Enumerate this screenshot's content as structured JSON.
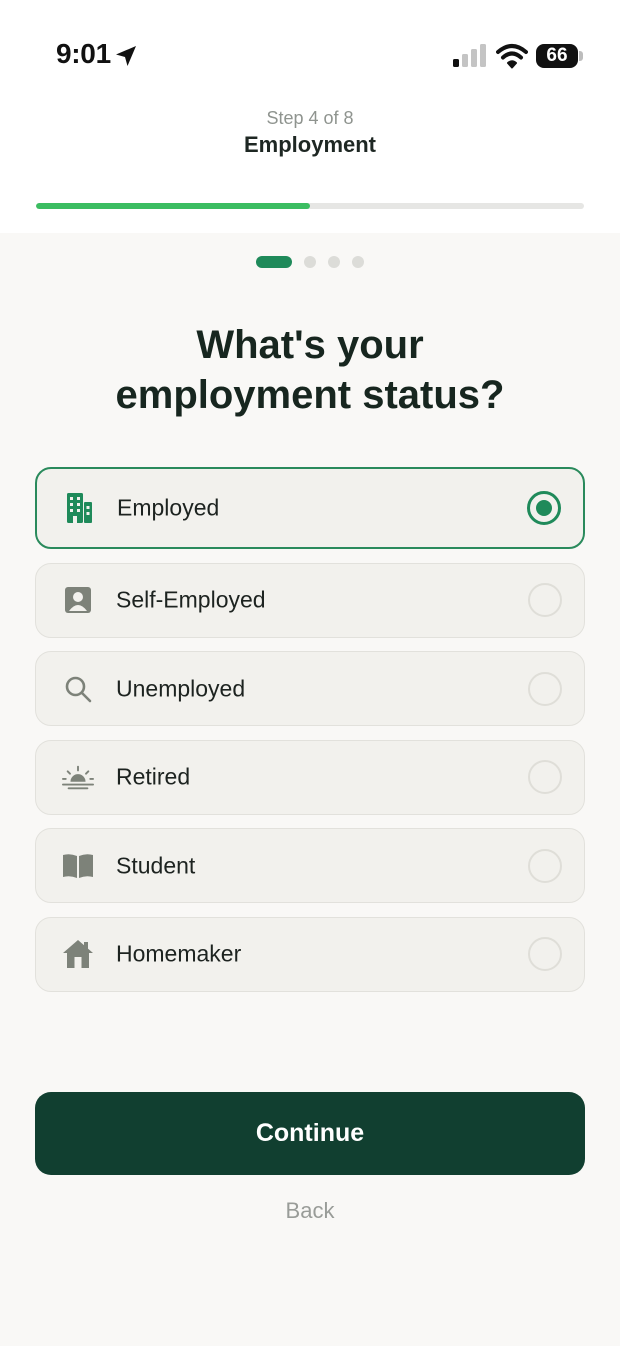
{
  "status_bar": {
    "time": "9:01",
    "battery": "66"
  },
  "header": {
    "step_label": "Step 4 of 8",
    "title": "Employment",
    "progress": 0.5
  },
  "page_dots": {
    "count": 4,
    "active_index": 0
  },
  "question": {
    "line1": "What's your",
    "line2": "employment status?"
  },
  "options": [
    {
      "label": "Employed",
      "icon": "building-icon",
      "selected": true
    },
    {
      "label": "Self-Employed",
      "icon": "person-badge-icon",
      "selected": false
    },
    {
      "label": "Unemployed",
      "icon": "search-icon",
      "selected": false
    },
    {
      "label": "Retired",
      "icon": "sunrise-icon",
      "selected": false
    },
    {
      "label": "Student",
      "icon": "book-icon",
      "selected": false
    },
    {
      "label": "Homemaker",
      "icon": "house-icon",
      "selected": false
    }
  ],
  "buttons": {
    "continue_label": "Continue",
    "back_label": "Back"
  },
  "colors": {
    "accent": "#1f8a5a",
    "progress": "#3bbd61",
    "primary_button": "#113f30",
    "background": "#f9f8f6",
    "icon_selected": "#1f8a5a",
    "icon_default": "#7d8279"
  }
}
